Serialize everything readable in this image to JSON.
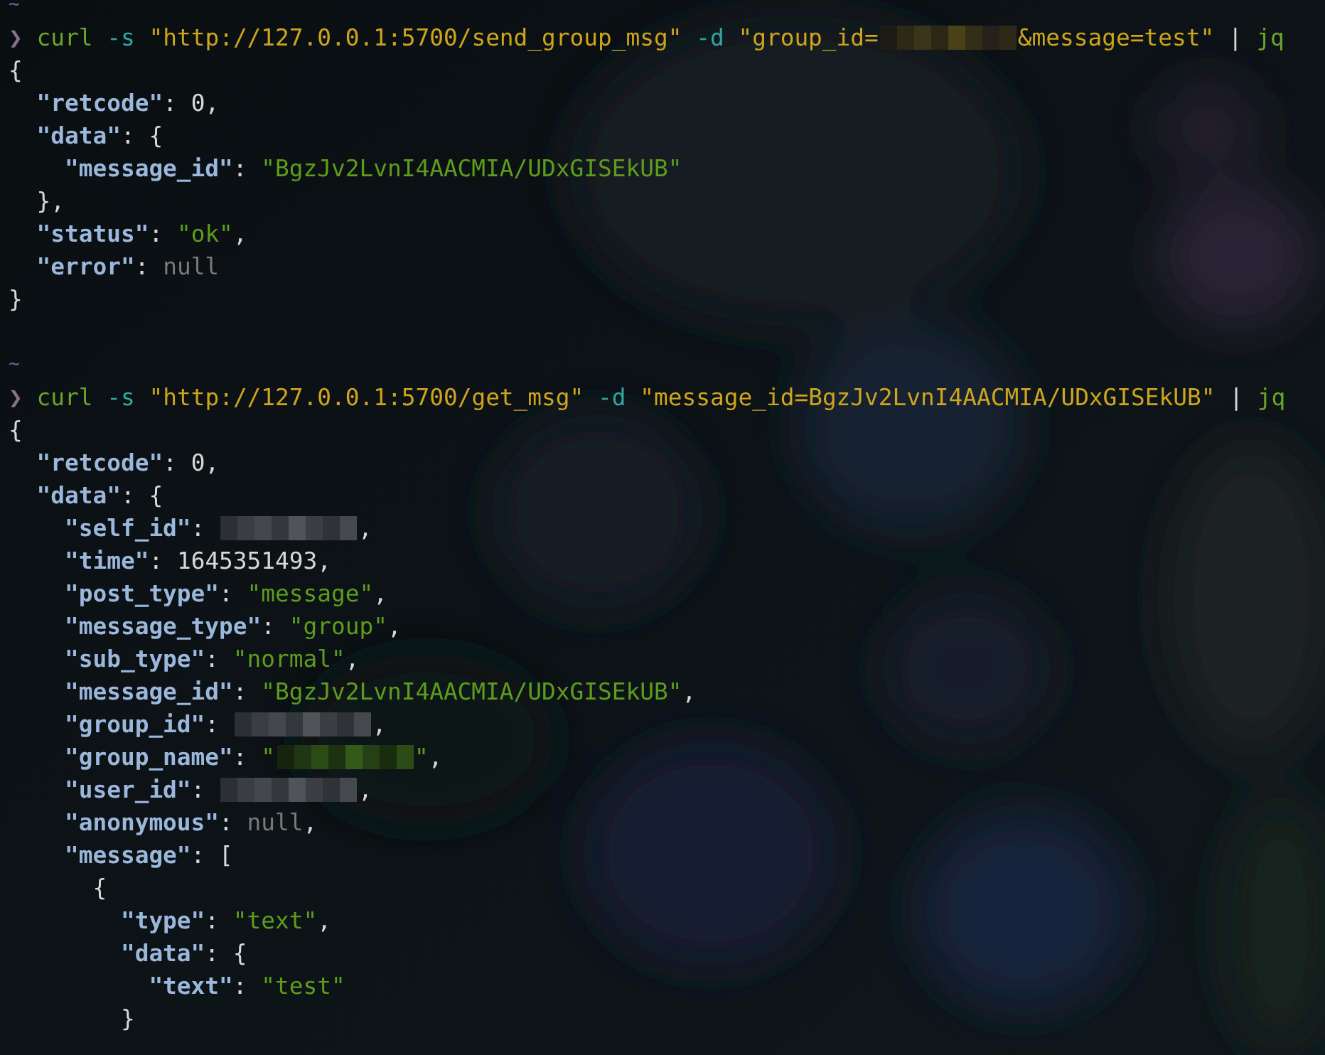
{
  "terminal": {
    "lines": [
      {
        "tokens": [
          {
            "kind": "tilde",
            "text": "~"
          }
        ]
      },
      {
        "tokens": [
          {
            "kind": "prompt",
            "text": "❯"
          },
          {
            "kind": "command",
            "text": " curl"
          },
          {
            "kind": "flag",
            "text": " -s"
          },
          {
            "kind": "argument",
            "text": " \"http://127.0.0.1:5700/send_group_msg\""
          },
          {
            "kind": "flag",
            "text": " -d"
          },
          {
            "kind": "argument",
            "text": " \"group_id="
          },
          {
            "kind": "redacted_yellow"
          },
          {
            "kind": "argument",
            "text": "&message=test\""
          },
          {
            "kind": "pipe",
            "text": " |"
          },
          {
            "kind": "command",
            "text": " jq"
          }
        ]
      },
      {
        "tokens": [
          {
            "kind": "punct",
            "text": "{"
          }
        ]
      },
      {
        "tokens": [
          {
            "kind": "key",
            "text": "  \"retcode\""
          },
          {
            "kind": "punct",
            "text": ":"
          },
          {
            "kind": "number",
            "text": " 0"
          },
          {
            "kind": "punct",
            "text": ","
          }
        ]
      },
      {
        "tokens": [
          {
            "kind": "key",
            "text": "  \"data\""
          },
          {
            "kind": "punct",
            "text": ":"
          },
          {
            "kind": "punct",
            "text": " {"
          }
        ]
      },
      {
        "tokens": [
          {
            "kind": "key",
            "text": "    \"message_id\""
          },
          {
            "kind": "punct",
            "text": ":"
          },
          {
            "kind": "string",
            "text": " \"BgzJv2LvnI4AACMIA/UDxGISEkUB\""
          }
        ]
      },
      {
        "tokens": [
          {
            "kind": "punct",
            "text": "  },"
          }
        ]
      },
      {
        "tokens": [
          {
            "kind": "key",
            "text": "  \"status\""
          },
          {
            "kind": "punct",
            "text": ":"
          },
          {
            "kind": "string",
            "text": " \"ok\""
          },
          {
            "kind": "punct",
            "text": ","
          }
        ]
      },
      {
        "tokens": [
          {
            "kind": "key",
            "text": "  \"error\""
          },
          {
            "kind": "punct",
            "text": ":"
          },
          {
            "kind": "null",
            "text": " null"
          }
        ]
      },
      {
        "tokens": [
          {
            "kind": "punct",
            "text": "}"
          }
        ]
      },
      {
        "blank_before": true,
        "tokens": [
          {
            "kind": "tilde",
            "text": "~"
          }
        ]
      },
      {
        "tokens": [
          {
            "kind": "prompt",
            "text": "❯"
          },
          {
            "kind": "command",
            "text": " curl"
          },
          {
            "kind": "flag",
            "text": " -s"
          },
          {
            "kind": "argument",
            "text": " \"http://127.0.0.1:5700/get_msg\""
          },
          {
            "kind": "flag",
            "text": " -d"
          },
          {
            "kind": "argument",
            "text": " \"message_id=BgzJv2LvnI4AACMIA/UDxGISEkUB\""
          },
          {
            "kind": "pipe",
            "text": " |"
          },
          {
            "kind": "command",
            "text": " jq"
          }
        ]
      },
      {
        "tokens": [
          {
            "kind": "punct",
            "text": "{"
          }
        ]
      },
      {
        "tokens": [
          {
            "kind": "key",
            "text": "  \"retcode\""
          },
          {
            "kind": "punct",
            "text": ":"
          },
          {
            "kind": "number",
            "text": " 0"
          },
          {
            "kind": "punct",
            "text": ","
          }
        ]
      },
      {
        "tokens": [
          {
            "kind": "key",
            "text": "  \"data\""
          },
          {
            "kind": "punct",
            "text": ":"
          },
          {
            "kind": "punct",
            "text": " {"
          }
        ]
      },
      {
        "tokens": [
          {
            "kind": "key",
            "text": "    \"self_id\""
          },
          {
            "kind": "punct",
            "text": ": "
          },
          {
            "kind": "redacted_grey"
          },
          {
            "kind": "punct",
            "text": ","
          }
        ]
      },
      {
        "tokens": [
          {
            "kind": "key",
            "text": "    \"time\""
          },
          {
            "kind": "punct",
            "text": ":"
          },
          {
            "kind": "number",
            "text": " 1645351493"
          },
          {
            "kind": "punct",
            "text": ","
          }
        ]
      },
      {
        "tokens": [
          {
            "kind": "key",
            "text": "    \"post_type\""
          },
          {
            "kind": "punct",
            "text": ":"
          },
          {
            "kind": "string",
            "text": " \"message\""
          },
          {
            "kind": "punct",
            "text": ","
          }
        ]
      },
      {
        "tokens": [
          {
            "kind": "key",
            "text": "    \"message_type\""
          },
          {
            "kind": "punct",
            "text": ":"
          },
          {
            "kind": "string",
            "text": " \"group\""
          },
          {
            "kind": "punct",
            "text": ","
          }
        ]
      },
      {
        "tokens": [
          {
            "kind": "key",
            "text": "    \"sub_type\""
          },
          {
            "kind": "punct",
            "text": ":"
          },
          {
            "kind": "string",
            "text": " \"normal\""
          },
          {
            "kind": "punct",
            "text": ","
          }
        ]
      },
      {
        "tokens": [
          {
            "kind": "key",
            "text": "    \"message_id\""
          },
          {
            "kind": "punct",
            "text": ":"
          },
          {
            "kind": "string",
            "text": " \"BgzJv2LvnI4AACMIA/UDxGISEkUB\""
          },
          {
            "kind": "punct",
            "text": ","
          }
        ]
      },
      {
        "tokens": [
          {
            "kind": "key",
            "text": "    \"group_id\""
          },
          {
            "kind": "punct",
            "text": ": "
          },
          {
            "kind": "redacted_grey"
          },
          {
            "kind": "punct",
            "text": ","
          }
        ]
      },
      {
        "tokens": [
          {
            "kind": "key",
            "text": "    \"group_name\""
          },
          {
            "kind": "punct",
            "text": ":"
          },
          {
            "kind": "string",
            "text": " \""
          },
          {
            "kind": "redacted_green"
          },
          {
            "kind": "string",
            "text": "\""
          },
          {
            "kind": "punct",
            "text": ","
          }
        ]
      },
      {
        "tokens": [
          {
            "kind": "key",
            "text": "    \"user_id\""
          },
          {
            "kind": "punct",
            "text": ": "
          },
          {
            "kind": "redacted_grey"
          },
          {
            "kind": "punct",
            "text": ","
          }
        ]
      },
      {
        "tokens": [
          {
            "kind": "key",
            "text": "    \"anonymous\""
          },
          {
            "kind": "punct",
            "text": ":"
          },
          {
            "kind": "null",
            "text": " null"
          },
          {
            "kind": "punct",
            "text": ","
          }
        ]
      },
      {
        "tokens": [
          {
            "kind": "key",
            "text": "    \"message\""
          },
          {
            "kind": "punct",
            "text": ":"
          },
          {
            "kind": "punct",
            "text": " ["
          }
        ]
      },
      {
        "tokens": [
          {
            "kind": "punct",
            "text": "      {"
          }
        ]
      },
      {
        "tokens": [
          {
            "kind": "key",
            "text": "        \"type\""
          },
          {
            "kind": "punct",
            "text": ":"
          },
          {
            "kind": "string",
            "text": " \"text\""
          },
          {
            "kind": "punct",
            "text": ","
          }
        ]
      },
      {
        "tokens": [
          {
            "kind": "key",
            "text": "        \"data\""
          },
          {
            "kind": "punct",
            "text": ":"
          },
          {
            "kind": "punct",
            "text": " {"
          }
        ]
      },
      {
        "tokens": [
          {
            "kind": "key",
            "text": "          \"text\""
          },
          {
            "kind": "punct",
            "text": ":"
          },
          {
            "kind": "string",
            "text": " \"test\""
          }
        ]
      },
      {
        "tokens": [
          {
            "kind": "punct",
            "text": "        }"
          }
        ]
      }
    ]
  }
}
